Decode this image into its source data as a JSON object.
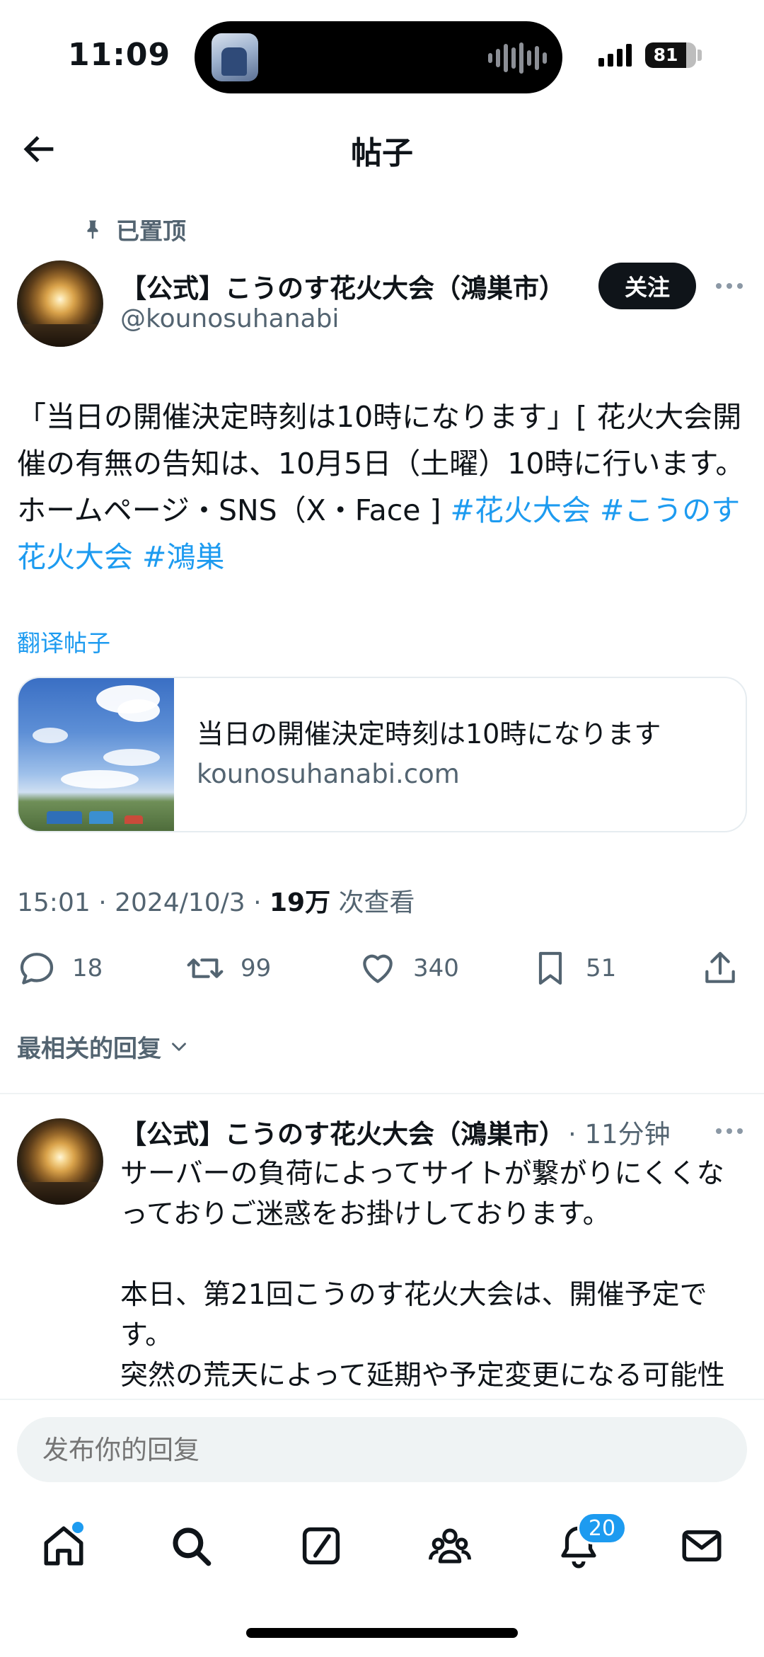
{
  "status_bar": {
    "time": "11:09",
    "battery": "81",
    "battery_level": 0.81
  },
  "header": {
    "title": "帖子"
  },
  "pinned_label": "已置顶",
  "post": {
    "author_name": "【公式】こうのす花火大会（鴻巣市）",
    "author_handle": "@kounosuhanabi",
    "follow_label": "关注",
    "body_text": "「当日の開催決定時刻は10時になります」[ 花火大会開催の有無の告知は、10月5日（土曜）10時に行います。ホームページ・SNS（X・Face ]  ",
    "hashtags": [
      "#花火大会",
      "#こうのす花火大会",
      "#鴻巣"
    ],
    "translate_label": "翻译帖子",
    "card": {
      "title": "当日の開催決定時刻は10時になります",
      "domain": "kounosuhanabi.com"
    },
    "meta": {
      "time_date": "15:01 · 2024/10/3 · ",
      "views": "19万",
      "views_label": " 次查看"
    },
    "actions": {
      "replies": "18",
      "reposts": "99",
      "likes": "340",
      "bookmarks": "51"
    }
  },
  "sort_label": "最相关的回复",
  "reply": {
    "author_name": "【公式】こうのす花火大会（鴻巣市）",
    "time": "· 11分钟",
    "body": "サーバーの負荷によってサイトが繋がりにくくなっておりご迷惑をお掛けしております。\n\n本日、第21回こうのす花火大会は、開催予定です。\n突然の荒天によって延期や予定変更になる可能性があります。"
  },
  "composer": {
    "placeholder": "发布你的回复"
  },
  "tabs": [
    {
      "name": "home-icon"
    },
    {
      "name": "search-icon"
    },
    {
      "name": "grok-icon"
    },
    {
      "name": "communities-icon"
    },
    {
      "name": "notifications-icon",
      "badge": "20"
    },
    {
      "name": "messages-icon"
    }
  ],
  "colors": {
    "accent": "#1d9bf0",
    "text": "#0f1419",
    "secondary": "#536471"
  }
}
